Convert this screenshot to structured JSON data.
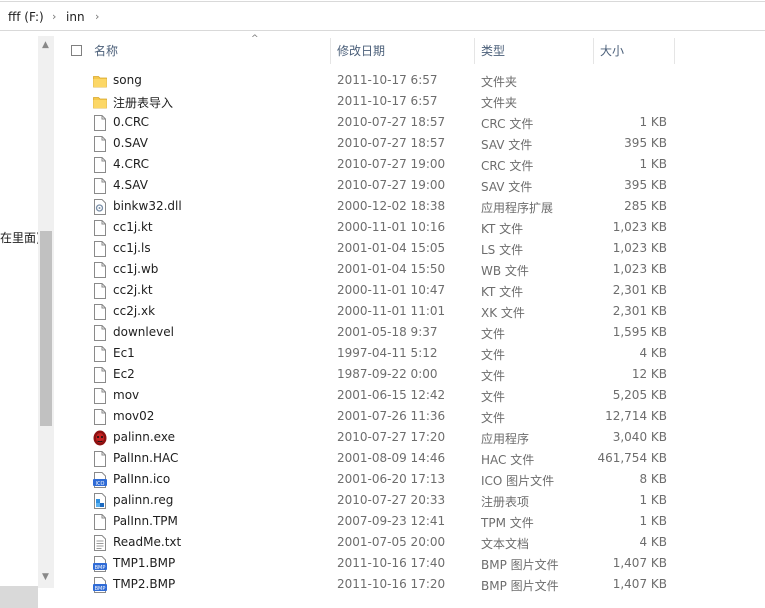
{
  "address": {
    "drive": "fff (F:)",
    "folder": "inn"
  },
  "left_pane": {
    "partial_text": "在里面)"
  },
  "columns": {
    "name": "名称",
    "date": "修改日期",
    "type": "类型",
    "size": "大小"
  },
  "files": [
    {
      "name": "song",
      "date": "2011-10-17 6:57",
      "type": "文件夹",
      "size": "",
      "icon": "folder-icon"
    },
    {
      "name": "注册表导入",
      "date": "2011-10-17 6:57",
      "type": "文件夹",
      "size": "",
      "icon": "folder-icon"
    },
    {
      "name": "0.CRC",
      "date": "2010-07-27 18:57",
      "type": "CRC 文件",
      "size": "1 KB",
      "icon": "file-icon"
    },
    {
      "name": "0.SAV",
      "date": "2010-07-27 18:57",
      "type": "SAV 文件",
      "size": "395 KB",
      "icon": "file-icon"
    },
    {
      "name": "4.CRC",
      "date": "2010-07-27 19:00",
      "type": "CRC 文件",
      "size": "1 KB",
      "icon": "file-icon"
    },
    {
      "name": "4.SAV",
      "date": "2010-07-27 19:00",
      "type": "SAV 文件",
      "size": "395 KB",
      "icon": "file-icon"
    },
    {
      "name": "binkw32.dll",
      "date": "2000-12-02 18:38",
      "type": "应用程序扩展",
      "size": "285 KB",
      "icon": "dll-icon"
    },
    {
      "name": "cc1j.kt",
      "date": "2000-11-01 10:16",
      "type": "KT 文件",
      "size": "1,023 KB",
      "icon": "file-icon"
    },
    {
      "name": "cc1j.ls",
      "date": "2001-01-04 15:05",
      "type": "LS 文件",
      "size": "1,023 KB",
      "icon": "file-icon"
    },
    {
      "name": "cc1j.wb",
      "date": "2001-01-04 15:50",
      "type": "WB 文件",
      "size": "1,023 KB",
      "icon": "file-icon"
    },
    {
      "name": "cc2j.kt",
      "date": "2000-11-01 10:47",
      "type": "KT 文件",
      "size": "2,301 KB",
      "icon": "file-icon"
    },
    {
      "name": "cc2j.xk",
      "date": "2000-11-01 11:01",
      "type": "XK 文件",
      "size": "2,301 KB",
      "icon": "file-icon"
    },
    {
      "name": "downlevel",
      "date": "2001-05-18 9:37",
      "type": "文件",
      "size": "1,595 KB",
      "icon": "file-icon"
    },
    {
      "name": "Ec1",
      "date": "1997-04-11 5:12",
      "type": "文件",
      "size": "4 KB",
      "icon": "file-icon"
    },
    {
      "name": "Ec2",
      "date": "1987-09-22 0:00",
      "type": "文件",
      "size": "12 KB",
      "icon": "file-icon"
    },
    {
      "name": "mov",
      "date": "2001-06-15 12:42",
      "type": "文件",
      "size": "5,205 KB",
      "icon": "file-icon"
    },
    {
      "name": "mov02",
      "date": "2001-07-26 11:36",
      "type": "文件",
      "size": "12,714 KB",
      "icon": "file-icon"
    },
    {
      "name": "palinn.exe",
      "date": "2010-07-27 17:20",
      "type": "应用程序",
      "size": "3,040 KB",
      "icon": "exe-icon"
    },
    {
      "name": "PalInn.HAC",
      "date": "2001-08-09 14:46",
      "type": "HAC 文件",
      "size": "461,754 KB",
      "icon": "file-icon"
    },
    {
      "name": "PalInn.ico",
      "date": "2001-06-20 17:13",
      "type": "ICO 图片文件",
      "size": "8 KB",
      "icon": "ico-icon"
    },
    {
      "name": "palinn.reg",
      "date": "2010-07-27 20:33",
      "type": "注册表项",
      "size": "1 KB",
      "icon": "reg-icon"
    },
    {
      "name": "PalInn.TPM",
      "date": "2007-09-23 12:41",
      "type": "TPM 文件",
      "size": "1 KB",
      "icon": "file-icon"
    },
    {
      "name": "ReadMe.txt",
      "date": "2001-07-05 20:00",
      "type": "文本文档",
      "size": "4 KB",
      "icon": "txt-icon"
    },
    {
      "name": "TMP1.BMP",
      "date": "2011-10-16 17:40",
      "type": "BMP 图片文件",
      "size": "1,407 KB",
      "icon": "bmp-icon"
    },
    {
      "name": "TMP2.BMP",
      "date": "2011-10-16 17:20",
      "type": "BMP 图片文件",
      "size": "1,407 KB",
      "icon": "bmp-icon"
    }
  ],
  "colors": {
    "header_text": "#4c607a",
    "secondary_text": "#6d6d6d",
    "folder": "#f5c84c"
  }
}
